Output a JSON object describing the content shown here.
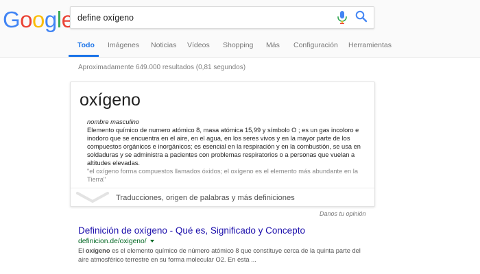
{
  "logo": {
    "letters": [
      "G",
      "o",
      "o",
      "g",
      "l",
      "e"
    ],
    "colors": [
      "#4285F4",
      "#EA4335",
      "#FBBC05",
      "#4285F4",
      "#34A853",
      "#EA4335"
    ]
  },
  "search": {
    "query": "define oxígeno",
    "mic_icon": "mic-icon",
    "search_icon": "search-icon"
  },
  "tabs": [
    {
      "label": "Todo",
      "active": true
    },
    {
      "label": "Imágenes"
    },
    {
      "label": "Noticias"
    },
    {
      "label": "Vídeos"
    },
    {
      "label": "Shopping"
    },
    {
      "label": "Más"
    },
    {
      "label": "Configuración"
    },
    {
      "label": "Herramientas"
    }
  ],
  "stats": "Aproximadamente 649.000 resultados (0,81 segundos)",
  "dictionary": {
    "word": "oxígeno",
    "part_of_speech": "nombre masculino",
    "definition": "Elemento químico de numero atómico 8, masa atómica 15,99 y símbolo O ; es un gas incoloro e inodoro que se encuentra en el aire, en el agua, en los seres vivos y en la mayor parte de los compuestos orgánicos e inorgánicos; es esencial en la respiración y en la combustión, se usa en soldaduras y se administra a pacientes con problemas respiratorios o a personas que vuelan a altitudes elevadas.",
    "example": "\"el oxígeno forma compuestos llamados óxidos; el oxígeno es el elemento más abundante en la Tierra\"",
    "more_label": "Traducciones, origen de palabras y más definiciones"
  },
  "feedback": "Danos tu opinión",
  "result": {
    "title": "Definición de oxígeno - Qué es, Significado y Concepto",
    "url": "definicion.de/oxigeno/",
    "snippet_pre": "El ",
    "snippet_bold": "oxígeno",
    "snippet_post": " es el elemento químico de número atómico 8 que constituye cerca de la quinta parte del aire atmosférico terrestre en su forma molecular O2. En esta ..."
  },
  "colors": {
    "link": "#1a0dab",
    "url": "#006621",
    "accent": "#1a73e8"
  }
}
